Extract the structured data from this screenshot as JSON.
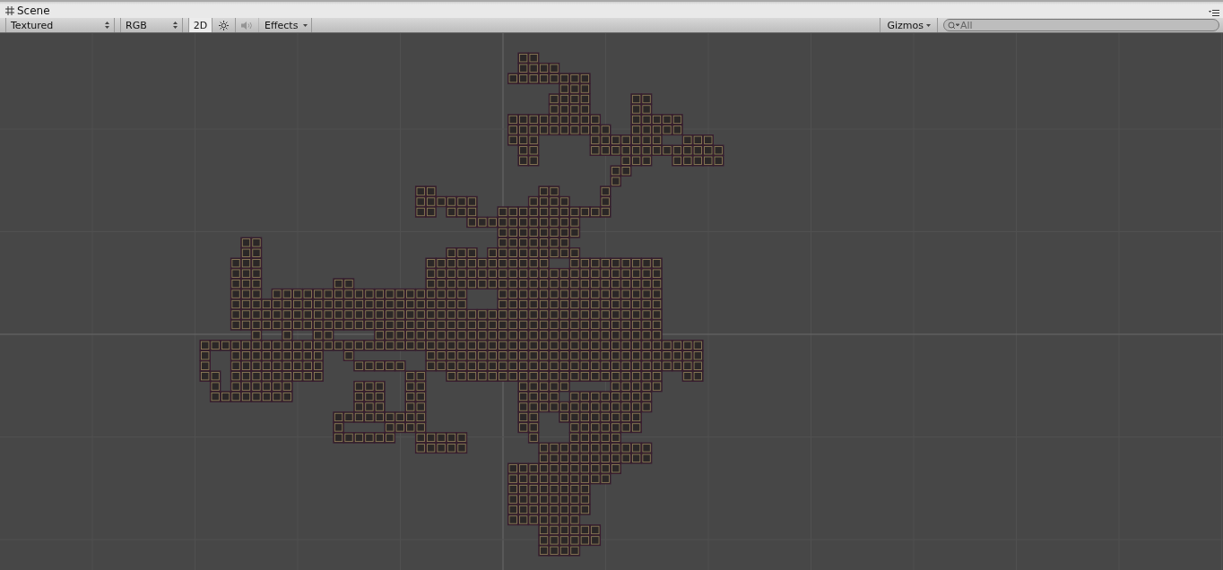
{
  "window": {
    "title": "Scene"
  },
  "toolbar": {
    "draw_mode": "Textured",
    "render_mode": "RGB",
    "toggles": [
      {
        "kind": "text",
        "label": "2D",
        "on": true,
        "disabled": false
      },
      {
        "kind": "lighting",
        "on": false,
        "disabled": false
      },
      {
        "kind": "audio",
        "on": false,
        "disabled": true
      }
    ],
    "effects": {
      "label": "Effects"
    },
    "gizmos": {
      "label": "Gizmos"
    },
    "search": {
      "placeholder": "All"
    }
  }
}
